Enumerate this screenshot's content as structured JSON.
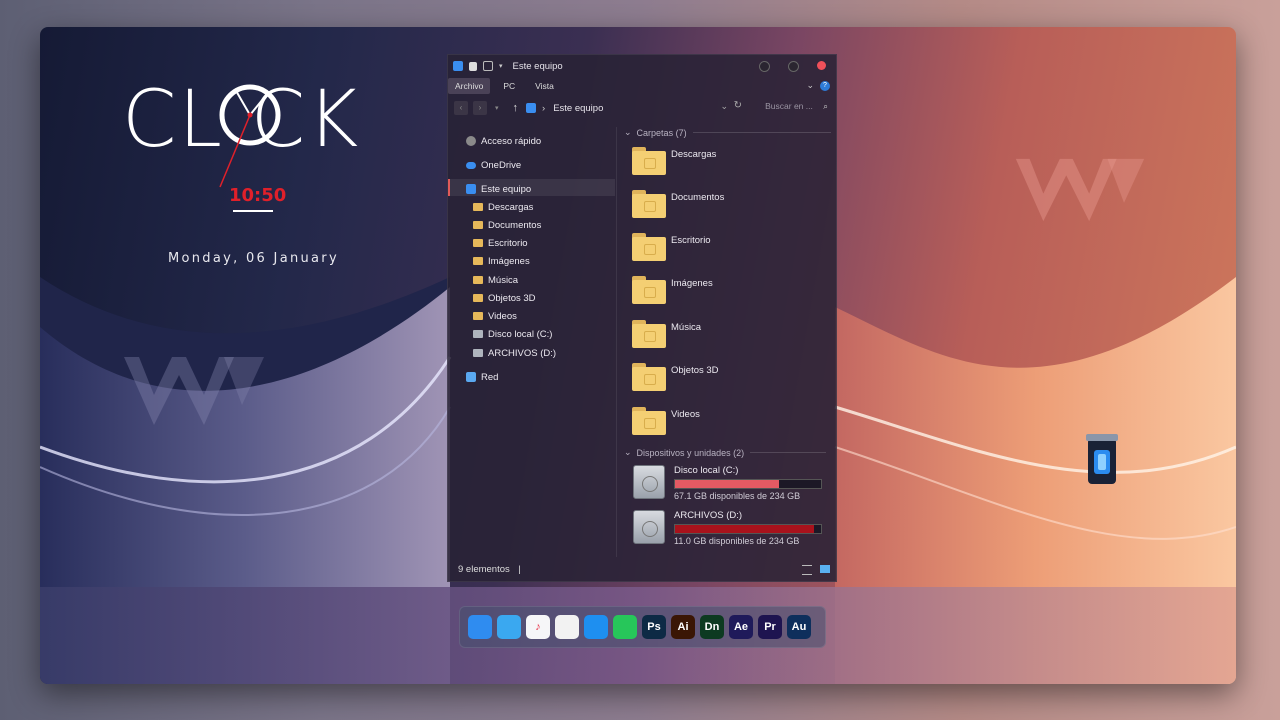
{
  "clock": {
    "title": "CL  CK",
    "time": "10:50",
    "date": "Monday, 06 January"
  },
  "explorer": {
    "window_title": "Este equipo",
    "ribbon_tabs": [
      "Archivo",
      "PC",
      "Vista"
    ],
    "help_label": "?",
    "address": "Este equipo",
    "search_placeholder": "Buscar en ...",
    "sidebar": [
      {
        "label": "Acceso rápido",
        "icon": "quick-access-icon"
      },
      {
        "label": "OneDrive",
        "icon": "onedrive-icon"
      },
      {
        "label": "Este equipo",
        "icon": "computer-icon"
      },
      {
        "label": "Descargas",
        "icon": "folder-icon"
      },
      {
        "label": "Documentos",
        "icon": "folder-icon"
      },
      {
        "label": "Escritorio",
        "icon": "folder-icon"
      },
      {
        "label": "Imágenes",
        "icon": "folder-icon"
      },
      {
        "label": "Música",
        "icon": "folder-icon"
      },
      {
        "label": "Objetos 3D",
        "icon": "folder-icon"
      },
      {
        "label": "Videos",
        "icon": "folder-icon"
      },
      {
        "label": "Disco local (C:)",
        "icon": "drive-icon"
      },
      {
        "label": "ARCHIVOS (D:)",
        "icon": "drive-icon"
      },
      {
        "label": "Red",
        "icon": "network-icon"
      }
    ],
    "folders_header": "Carpetas (7)",
    "folders": [
      "Descargas",
      "Documentos",
      "Escritorio",
      "Imágenes",
      "Música",
      "Objetos 3D",
      "Videos"
    ],
    "drives_header": "Dispositivos y unidades (2)",
    "drives": [
      {
        "name": "Disco local (C:)",
        "free": "67.1 GB disponibles de 234 GB",
        "used_fraction": 0.71,
        "color": "#e45a63"
      },
      {
        "name": "ARCHIVOS (D:)",
        "free": "11.0 GB disponibles de 234 GB",
        "used_fraction": 0.95,
        "color": "#a8121c"
      }
    ],
    "status": "9 elementos",
    "status_sep": "|"
  },
  "dock": [
    {
      "label": "",
      "icon": "finder-icon",
      "color": "#2f8cf0"
    },
    {
      "label": "",
      "icon": "folder-icon",
      "color": "#3aa8f0"
    },
    {
      "label": "♪",
      "icon": "music-icon",
      "color": "#f6f6f8"
    },
    {
      "label": "",
      "icon": "photos-icon",
      "color": "#f2f2f2"
    },
    {
      "label": "",
      "icon": "safari-icon",
      "color": "#1e8ff0"
    },
    {
      "label": "",
      "icon": "facetime-icon",
      "color": "#27c65a"
    },
    {
      "label": "Ps",
      "icon": "photoshop-icon",
      "color": "#0d2a45"
    },
    {
      "label": "Ai",
      "icon": "illustrator-icon",
      "color": "#3a1605"
    },
    {
      "label": "Dn",
      "icon": "dimension-icon",
      "color": "#0d3a21"
    },
    {
      "label": "Ae",
      "icon": "aftereffects-icon",
      "color": "#1f1a5a"
    },
    {
      "label": "Pr",
      "icon": "premiere-icon",
      "color": "#1e1450"
    },
    {
      "label": "Au",
      "icon": "audition-icon",
      "color": "#0e2f5c"
    }
  ],
  "colors": {
    "accent_red": "#e0202a",
    "folder": "#f4cf73"
  }
}
